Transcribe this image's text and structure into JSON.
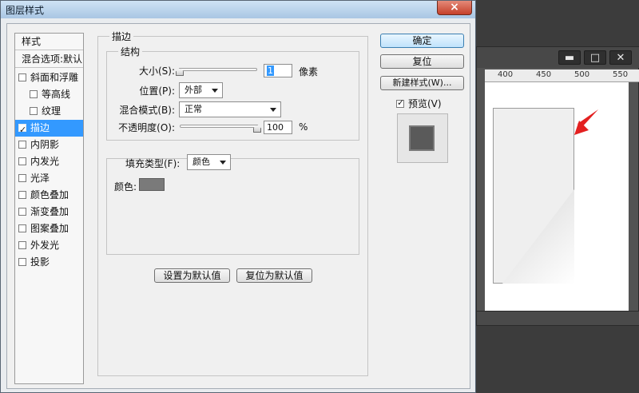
{
  "dialog": {
    "title": "图层样式",
    "close_icon": "×"
  },
  "sidebar": {
    "styles_label": "样式",
    "blend_label": "混合选项:默认",
    "items": [
      {
        "label": "斜面和浮雕",
        "checked": false,
        "indent": false
      },
      {
        "label": "等高线",
        "checked": false,
        "indent": true
      },
      {
        "label": "纹理",
        "checked": false,
        "indent": true
      },
      {
        "label": "描边",
        "checked": true,
        "indent": false,
        "selected": true
      },
      {
        "label": "内阴影",
        "checked": false,
        "indent": false
      },
      {
        "label": "内发光",
        "checked": false,
        "indent": false
      },
      {
        "label": "光泽",
        "checked": false,
        "indent": false
      },
      {
        "label": "颜色叠加",
        "checked": false,
        "indent": false
      },
      {
        "label": "渐变叠加",
        "checked": false,
        "indent": false
      },
      {
        "label": "图案叠加",
        "checked": false,
        "indent": false
      },
      {
        "label": "外发光",
        "checked": false,
        "indent": false
      },
      {
        "label": "投影",
        "checked": false,
        "indent": false
      }
    ]
  },
  "stroke": {
    "section_title": "描边",
    "structure_title": "结构",
    "size": {
      "label": "大小(S):",
      "value": "1",
      "unit": "像素",
      "slider_fraction": 0.0
    },
    "position": {
      "label": "位置(P):",
      "value": "外部"
    },
    "blend_mode": {
      "label": "混合模式(B):",
      "value": "正常"
    },
    "opacity": {
      "label": "不透明度(O):",
      "value": "100",
      "unit": "%",
      "slider_fraction": 1.0
    },
    "fill_type": {
      "label": "填充类型(F):",
      "value": "颜色"
    },
    "color": {
      "label": "颜色:",
      "hex": "#7a7a7a"
    },
    "make_default": "设置为默认值",
    "reset_default": "复位为默认值"
  },
  "buttons": {
    "ok": "确定",
    "reset": "复位",
    "new_style": "新建样式(W)...",
    "preview_label": "预览(V)",
    "preview_checked": true
  },
  "background_window": {
    "ruler_ticks": [
      "400",
      "450",
      "500",
      "550"
    ],
    "minimize_icon": "▬",
    "maximize_icon": "□",
    "close_icon": "✕"
  },
  "colors": {
    "accent_selection": "#3399ff",
    "arrow": "#e32020"
  }
}
